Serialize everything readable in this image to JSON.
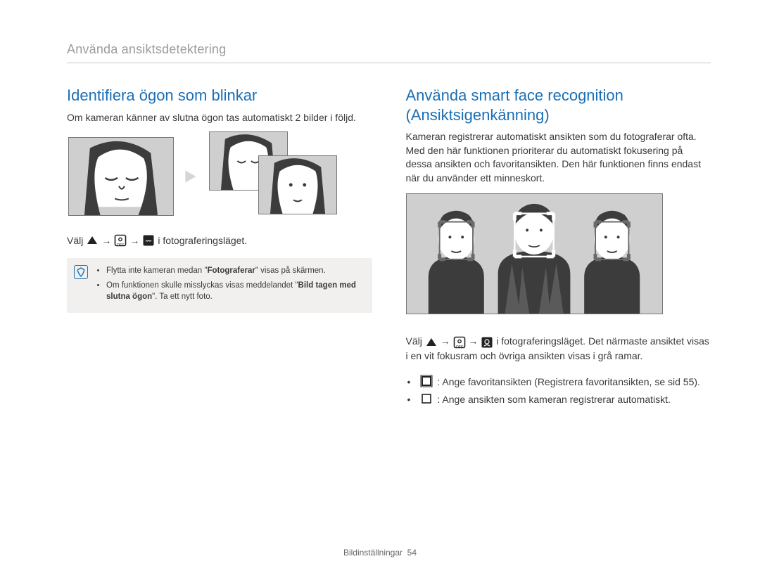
{
  "breadcrumb": "Använda ansiktsdetektering",
  "left": {
    "heading": "Identifiera ögon som blinkar",
    "intro": "Om kameran känner av slutna ögon tas automatiskt 2 bilder i följd.",
    "instr_prefix": "Välj",
    "instr_suffix": "i fotograferingsläget.",
    "arrow": "→",
    "note_bullets": [
      {
        "pre": "Flytta inte kameran medan \"",
        "strong": "Fotograferar",
        "post": "\" visas på skärmen."
      },
      {
        "pre": "Om funktionen skulle misslyckas visas meddelandet \"",
        "strong": "Bild tagen med slutna ögon",
        "post": "\". Ta ett nytt foto."
      }
    ]
  },
  "right": {
    "heading": "Använda smart face recognition (Ansiktsigenkänning)",
    "intro": "Kameran registrerar automatiskt ansikten som du fotograferar ofta. Med den här funktionen prioriterar du automatiskt fokusering på dessa ansikten och favoritansikten. Den här funktionen finns endast när du använder ett minneskort.",
    "instr_prefix": "Välj",
    "arrow": "→",
    "instr_mid": "i fotograferingsläget. Det närmaste ansiktet visas i en vit fokusram och övriga ansikten visas i grå ramar.",
    "bullet1_text": ": Ange favoritansikten (Registrera favoritansikten, se sid 55).",
    "bullet2_text": ": Ange ansikten som kameran registrerar automatiskt."
  },
  "footer": {
    "section": "Bildinställningar",
    "page": "54"
  }
}
